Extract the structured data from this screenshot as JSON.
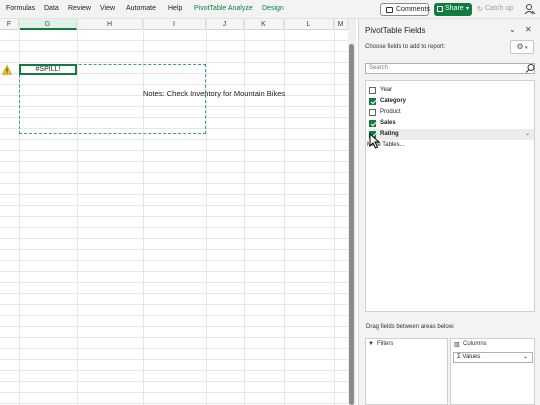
{
  "menu": {
    "items": [
      "Formulas",
      "Data",
      "Review",
      "View",
      "Automate",
      "Help",
      "PivotTable Analyze",
      "Design"
    ],
    "comments_label": "Comments",
    "share_label": "Share",
    "catchup_label": "Catch up"
  },
  "grid": {
    "columns": [
      "F",
      "G",
      "H",
      "I",
      "J",
      "K",
      "L",
      "M"
    ],
    "active_column": "G",
    "spill_cell_value": "#SPILL!",
    "notes_text": "Notes: Check Inventory for Mountain Bikes"
  },
  "pivot_pane": {
    "title": "PivotTable Fields",
    "choose_label": "Choose fields to add to report:",
    "search_placeholder": "Search",
    "fields": [
      {
        "label": "Year",
        "checked": false
      },
      {
        "label": "Category",
        "checked": true
      },
      {
        "label": "Product",
        "checked": false
      },
      {
        "label": "Sales",
        "checked": true
      },
      {
        "label": "Rating",
        "checked": true
      }
    ],
    "more_tables_label": "More Tables...",
    "drag_label": "Drag fields between areas below:",
    "filters_label": "Filters",
    "columns_label": "Columns",
    "values_chip_label": "Values"
  },
  "colors": {
    "accent": "#107c41"
  }
}
